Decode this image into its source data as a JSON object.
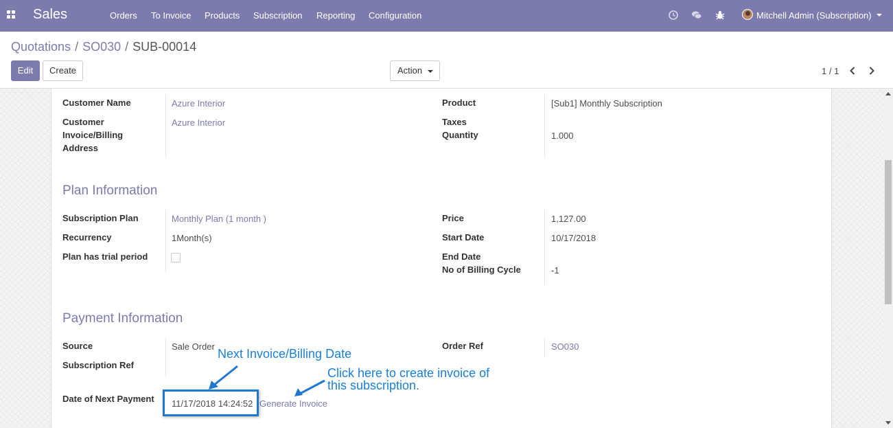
{
  "navbar": {
    "brand": "Sales",
    "menu": [
      "Orders",
      "To Invoice",
      "Products",
      "Subscription",
      "Reporting",
      "Configuration"
    ],
    "user": "Mitchell Admin (Subscription)",
    "icons": [
      "apps-grid-icon",
      "clock-icon",
      "chat-icon",
      "bug-icon"
    ]
  },
  "breadcrumb": {
    "items": [
      "Quotations",
      "SO030"
    ],
    "separator": "/",
    "current": "SUB-00014"
  },
  "buttons": {
    "edit": "Edit",
    "create": "Create",
    "action": "Action"
  },
  "pager": {
    "text": "1 / 1"
  },
  "form": {
    "top_left": [
      {
        "label": "Customer Name",
        "value": "Azure Interior"
      },
      {
        "label": "Customer Invoice/Billing Address",
        "value": "Azure Interior"
      }
    ],
    "top_right": [
      {
        "label": "Product",
        "value": "[Sub1] Monthly Subscription"
      },
      {
        "label": "Taxes",
        "value": ""
      },
      {
        "label": "Quantity",
        "value": "1.000"
      }
    ],
    "plan_title": "Plan Information",
    "plan_left": [
      {
        "label": "Subscription Plan",
        "value": "Monthly Plan (1 month )"
      },
      {
        "label": "Recurrency",
        "value": "1Month(s)"
      },
      {
        "label": "Plan has trial period",
        "value": ""
      }
    ],
    "plan_right": [
      {
        "label": "Price",
        "value": "1,127.00"
      },
      {
        "label": "Start Date",
        "value": "10/17/2018"
      },
      {
        "label": "End Date",
        "value": ""
      },
      {
        "label": "No of Billing Cycle",
        "value": "-1"
      }
    ],
    "payment_title": "Payment Information",
    "payment_left": [
      {
        "label": "Source",
        "value": "Sale Order"
      },
      {
        "label": "Subscription Ref",
        "value": ""
      },
      {
        "label": "Date of Next Payment",
        "value": "11/17/2018 14:24:52"
      }
    ],
    "payment_right": [
      {
        "label": "Order Ref",
        "value": "SO030"
      }
    ],
    "generate_invoice": "Generate Invoice"
  },
  "annotations": {
    "next_invoice": "Next Invoice/Billing Date",
    "click_here_line1": "Click here to create invoice of",
    "click_here_line2": "this subscription.",
    "color": "#1a7fd6"
  },
  "colors": {
    "primary": "#7c7bad",
    "annotation": "#1f77d0"
  }
}
